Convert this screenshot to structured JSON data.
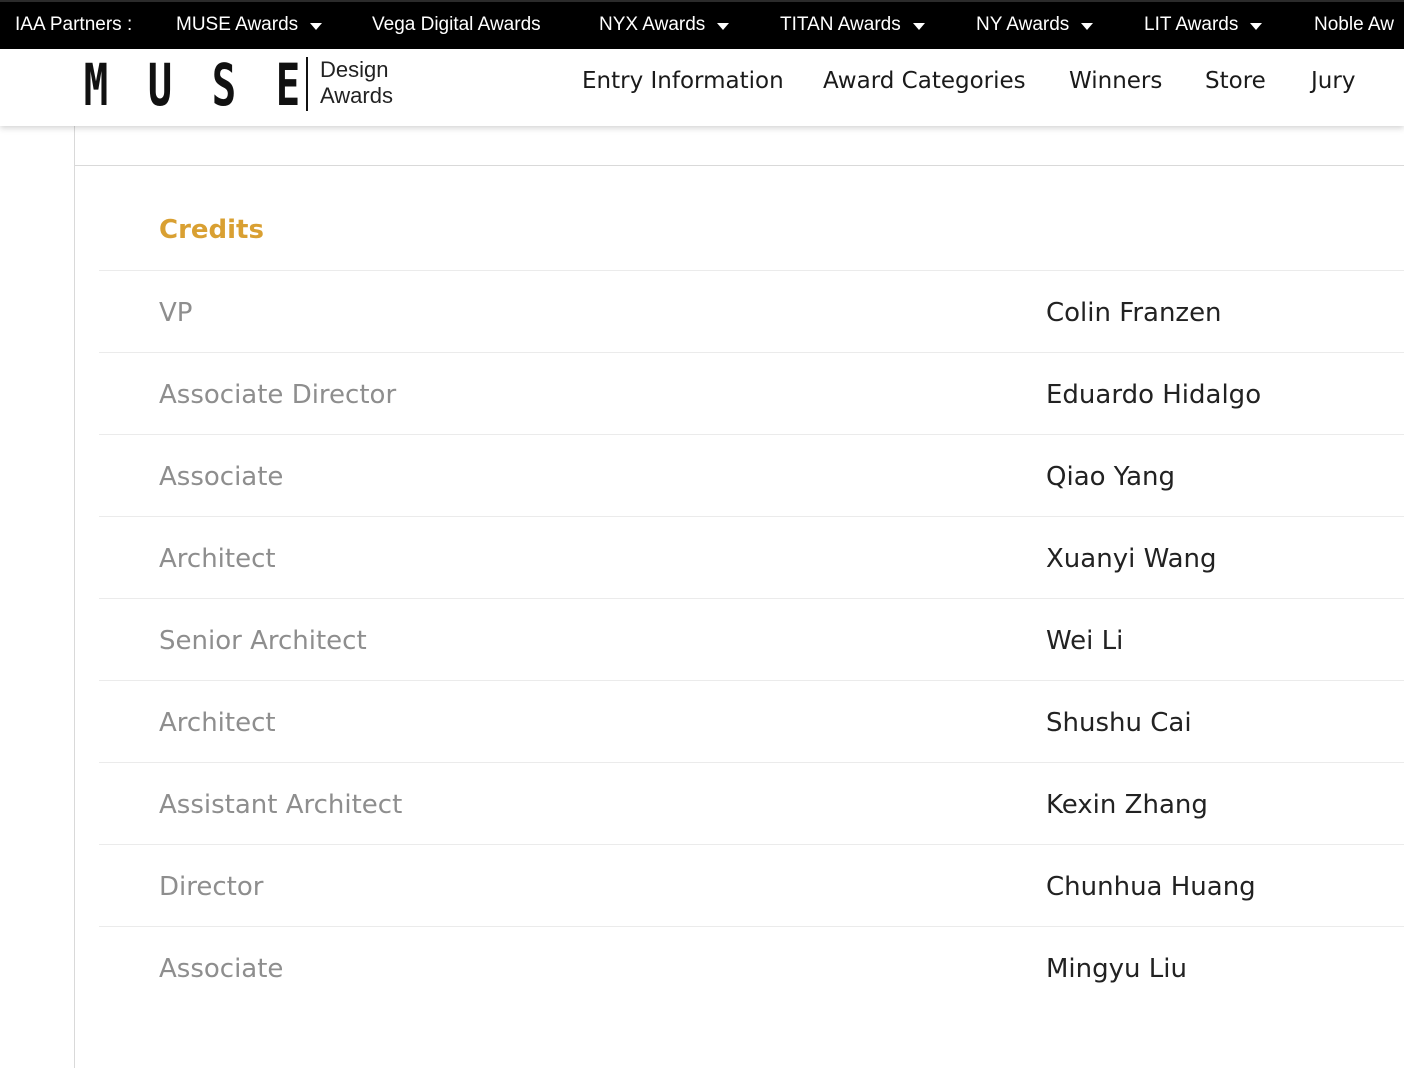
{
  "partner_bar": {
    "label": "IAA Partners :",
    "items": [
      {
        "label": "MUSE Awards",
        "dropdown": true
      },
      {
        "label": "Vega Digital Awards",
        "dropdown": false
      },
      {
        "label": "NYX Awards",
        "dropdown": true
      },
      {
        "label": "TITAN Awards",
        "dropdown": true
      },
      {
        "label": "NY Awards",
        "dropdown": true
      },
      {
        "label": "LIT Awards",
        "dropdown": true
      },
      {
        "label": "Noble Aw",
        "dropdown": false
      }
    ]
  },
  "logo": {
    "letters": [
      "M",
      "U",
      "S",
      "E"
    ],
    "line1": "Design",
    "line2": "Awards"
  },
  "nav": {
    "items": [
      {
        "label": "Entry Information"
      },
      {
        "label": "Award Categories"
      },
      {
        "label": "Winners"
      },
      {
        "label": "Store"
      },
      {
        "label": "Jury"
      }
    ]
  },
  "credits": {
    "heading": "Credits",
    "rows": [
      {
        "role": "VP",
        "name": "Colin Franzen"
      },
      {
        "role": "Associate Director",
        "name": "Eduardo Hidalgo"
      },
      {
        "role": "Associate",
        "name": "Qiao Yang"
      },
      {
        "role": "Architect",
        "name": "Xuanyi Wang"
      },
      {
        "role": "Senior Architect",
        "name": "Wei Li"
      },
      {
        "role": "Architect",
        "name": "Shushu Cai"
      },
      {
        "role": "Assistant Architect",
        "name": "Kexin Zhang"
      },
      {
        "role": "Director",
        "name": "Chunhua Huang"
      },
      {
        "role": "Associate",
        "name": "Mingyu Liu"
      }
    ]
  },
  "colors": {
    "partner_bar_bg": "#000000",
    "credits_heading": "#d9a032",
    "role_text": "#8e8e8e",
    "name_text": "#222222"
  }
}
